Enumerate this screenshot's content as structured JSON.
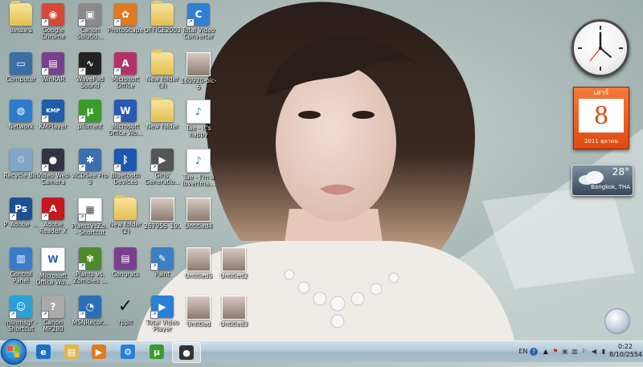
{
  "desktop_icons": [
    {
      "name": "icon-user-folder",
      "label": "แทนเดน",
      "type": "folder",
      "color": "#e5bf4f",
      "glyph": ""
    },
    {
      "name": "icon-google-chrome",
      "label": "Google Chrome",
      "type": "app",
      "color": "#d64936",
      "glyph": "◉",
      "shortcut": true
    },
    {
      "name": "icon-canon-solution",
      "label": "Canon Solutio...",
      "type": "app",
      "color": "#8a8a8a",
      "glyph": "▣",
      "shortcut": true
    },
    {
      "name": "icon-photoscape",
      "label": "PhotoScape",
      "type": "app",
      "color": "#e07a20",
      "glyph": "✿",
      "shortcut": true
    },
    {
      "name": "icon-office2003",
      "label": "OFFICE2003",
      "type": "folder",
      "color": "#e5bf4f",
      "glyph": ""
    },
    {
      "name": "icon-total-video-converter",
      "label": "Total Video Converter",
      "type": "app",
      "color": "#2f7fd6",
      "glyph": "C",
      "shortcut": true
    },
    {
      "name": "icon-computer",
      "label": "Computer",
      "type": "app",
      "color": "#3b6ea5",
      "glyph": "▭"
    },
    {
      "name": "icon-winrar",
      "label": "WinRAR",
      "type": "app",
      "color": "#7a3f8f",
      "glyph": "▤",
      "shortcut": true
    },
    {
      "name": "icon-wavepad",
      "label": "WavePad Sound Editor",
      "type": "app",
      "color": "#222",
      "glyph": "∿",
      "shortcut": true
    },
    {
      "name": "icon-microsoft-access",
      "label": "Microsoft Office Acce...",
      "type": "app",
      "color": "#b5306b",
      "glyph": "A",
      "shortcut": true
    },
    {
      "name": "icon-new-folder-3",
      "label": "New folder (3)",
      "type": "folder",
      "color": "#e5bf4f",
      "glyph": ""
    },
    {
      "name": "icon-160920-pic",
      "label": "160920-pic-6",
      "type": "thumb",
      "color": "#8a7a70",
      "glyph": ""
    },
    {
      "name": "icon-network",
      "label": "Network",
      "type": "app",
      "color": "#2c7cc9",
      "glyph": "◍"
    },
    {
      "name": "icon-kmplayer",
      "label": "KMPlayer",
      "type": "app",
      "color": "#1e5da8",
      "glyph": "KMP",
      "shortcut": true
    },
    {
      "name": "icon-utorrent",
      "label": "µTorrent",
      "type": "app",
      "color": "#3a9a2a",
      "glyph": "µ",
      "shortcut": true
    },
    {
      "name": "icon-microsoft-word",
      "label": "Microsoft Office Wo...",
      "type": "app",
      "color": "#2a59b3",
      "glyph": "W",
      "shortcut": true
    },
    {
      "name": "icon-new-folder",
      "label": "New folder",
      "type": "folder",
      "color": "#e5bf4f",
      "glyph": ""
    },
    {
      "name": "icon-tae-mp3",
      "label": "Tae - It's happy line...",
      "type": "doc",
      "color": "#2a59b3",
      "glyph": "♪"
    },
    {
      "name": "icon-recycle-bin",
      "label": "Recycle Bin",
      "type": "app",
      "color": "#7fa6c8",
      "glyph": "♲"
    },
    {
      "name": "icon-video-web-camera",
      "label": "Video Web Camera",
      "type": "app",
      "color": "#334",
      "glyph": "●",
      "shortcut": true
    },
    {
      "name": "icon-acdsee",
      "label": "ACDSee Pro 3",
      "type": "app",
      "color": "#3a6fb0",
      "glyph": "✱",
      "shortcut": true
    },
    {
      "name": "icon-bluetooth-devices",
      "label": "Bluetooth Devices",
      "type": "app",
      "color": "#1f56b0",
      "glyph": "ᛒ",
      "shortcut": true
    },
    {
      "name": "icon-girls-generation",
      "label": "Girls' Generatio...",
      "type": "app",
      "color": "#555",
      "glyph": "▶",
      "shortcut": true
    },
    {
      "name": "icon-tae-mp3-2",
      "label": "Tae - I'm a lover(ma...",
      "type": "doc",
      "color": "#2a59b3",
      "glyph": "♪"
    },
    {
      "name": "icon-photoshop",
      "label": "P_Adobe_...",
      "type": "app",
      "color": "#1d4f91",
      "glyph": "Ps",
      "shortcut": true
    },
    {
      "name": "icon-adobe-reader",
      "label": "Adobe Reader X",
      "type": "app",
      "color": "#c8171d",
      "glyph": "A",
      "shortcut": true
    },
    {
      "name": "icon-plantsvz-shortcut",
      "label": "PlantsVsZo... - Shortcut",
      "type": "doc",
      "color": "#444",
      "glyph": "▦",
      "shortcut": true
    },
    {
      "name": "icon-new-folder-2",
      "label": "New folder (2)",
      "type": "folder",
      "color": "#e5bf4f",
      "glyph": ""
    },
    {
      "name": "icon-267956",
      "label": "267956_199...",
      "type": "thumb",
      "color": "#8a7a70",
      "glyph": ""
    },
    {
      "name": "icon-untitled4",
      "label": "Untitled4",
      "type": "thumb",
      "color": "#8a7a70",
      "glyph": ""
    },
    {
      "name": "icon-control-panel",
      "label": "Control Panel",
      "type": "app",
      "color": "#3a7cc8",
      "glyph": "▥"
    },
    {
      "name": "icon-microsoft-word-2",
      "label": "Microsoft Office Wo...",
      "type": "doc",
      "color": "#2a59b3",
      "glyph": "W"
    },
    {
      "name": "icon-plants-vs-zombies",
      "label": "Plants vs. Zombies ...",
      "type": "app",
      "color": "#4d8a2a",
      "glyph": "✾",
      "shortcut": true
    },
    {
      "name": "icon-congrats",
      "label": "Congrats",
      "type": "app",
      "color": "#7a3f8f",
      "glyph": "▤"
    },
    {
      "name": "icon-paint",
      "label": "Paint",
      "type": "app",
      "color": "#3b7fc4",
      "glyph": "✎",
      "shortcut": true
    },
    {
      "name": "icon-untitled5",
      "label": "Untitled5",
      "type": "thumb",
      "color": "#8a7a70",
      "glyph": ""
    },
    {
      "name": "icon-untitled2",
      "label": "Untitled2",
      "type": "thumb",
      "color": "#8a7a70",
      "glyph": ""
    },
    {
      "name": "icon-msn-messenger",
      "label": "msnmsgr - Shortcut",
      "type": "app",
      "color": "#2aa0d8",
      "glyph": "☺",
      "shortcut": true
    },
    {
      "name": "icon-canon-mp280",
      "label": "Canon MP280 seri...",
      "type": "app",
      "color": "#aaa",
      "glyph": "?",
      "shortcut": true
    },
    {
      "name": "icon-msn-recorder",
      "label": "MSNRecor...",
      "type": "app",
      "color": "#2a6fb8",
      "glyph": "◔",
      "shortcut": true
    },
    {
      "name": "icon-rpplt",
      "label": "rpplt",
      "type": "check",
      "color": "#111",
      "glyph": "✓"
    },
    {
      "name": "icon-total-video-player",
      "label": "Total Video Player",
      "type": "app",
      "color": "#2a7fd6",
      "glyph": "▶",
      "shortcut": true
    },
    {
      "name": "icon-untitled",
      "label": "Untitled",
      "type": "thumb",
      "color": "#8a7a70",
      "glyph": ""
    },
    {
      "name": "icon-untitled3",
      "label": "Untitled3",
      "type": "thumb",
      "color": "#8a7a70",
      "glyph": ""
    }
  ],
  "gadgets": {
    "calendar": {
      "weekday": "เสาร์",
      "day": "8",
      "footer": "2011 ตุลาคม"
    },
    "weather": {
      "temperature": "28°",
      "location": "Bangkok, THA"
    }
  },
  "taskbar": {
    "pinned": [
      {
        "name": "taskbar-internet-explorer",
        "glyph": "e",
        "color": "#1e6fc8"
      },
      {
        "name": "taskbar-windows-explorer",
        "glyph": "▤",
        "color": "#e2b84a"
      },
      {
        "name": "taskbar-media-player",
        "glyph": "▶",
        "color": "#e07a20"
      },
      {
        "name": "taskbar-network-app",
        "glyph": "⚙",
        "color": "#2a7fd6"
      },
      {
        "name": "taskbar-utorrent",
        "glyph": "µ",
        "color": "#3a9a2a"
      },
      {
        "name": "taskbar-camera",
        "glyph": "●",
        "color": "#333"
      }
    ],
    "tray": {
      "language": "EN",
      "help": "?",
      "time": "0:22",
      "date": "8/10/2554"
    }
  }
}
